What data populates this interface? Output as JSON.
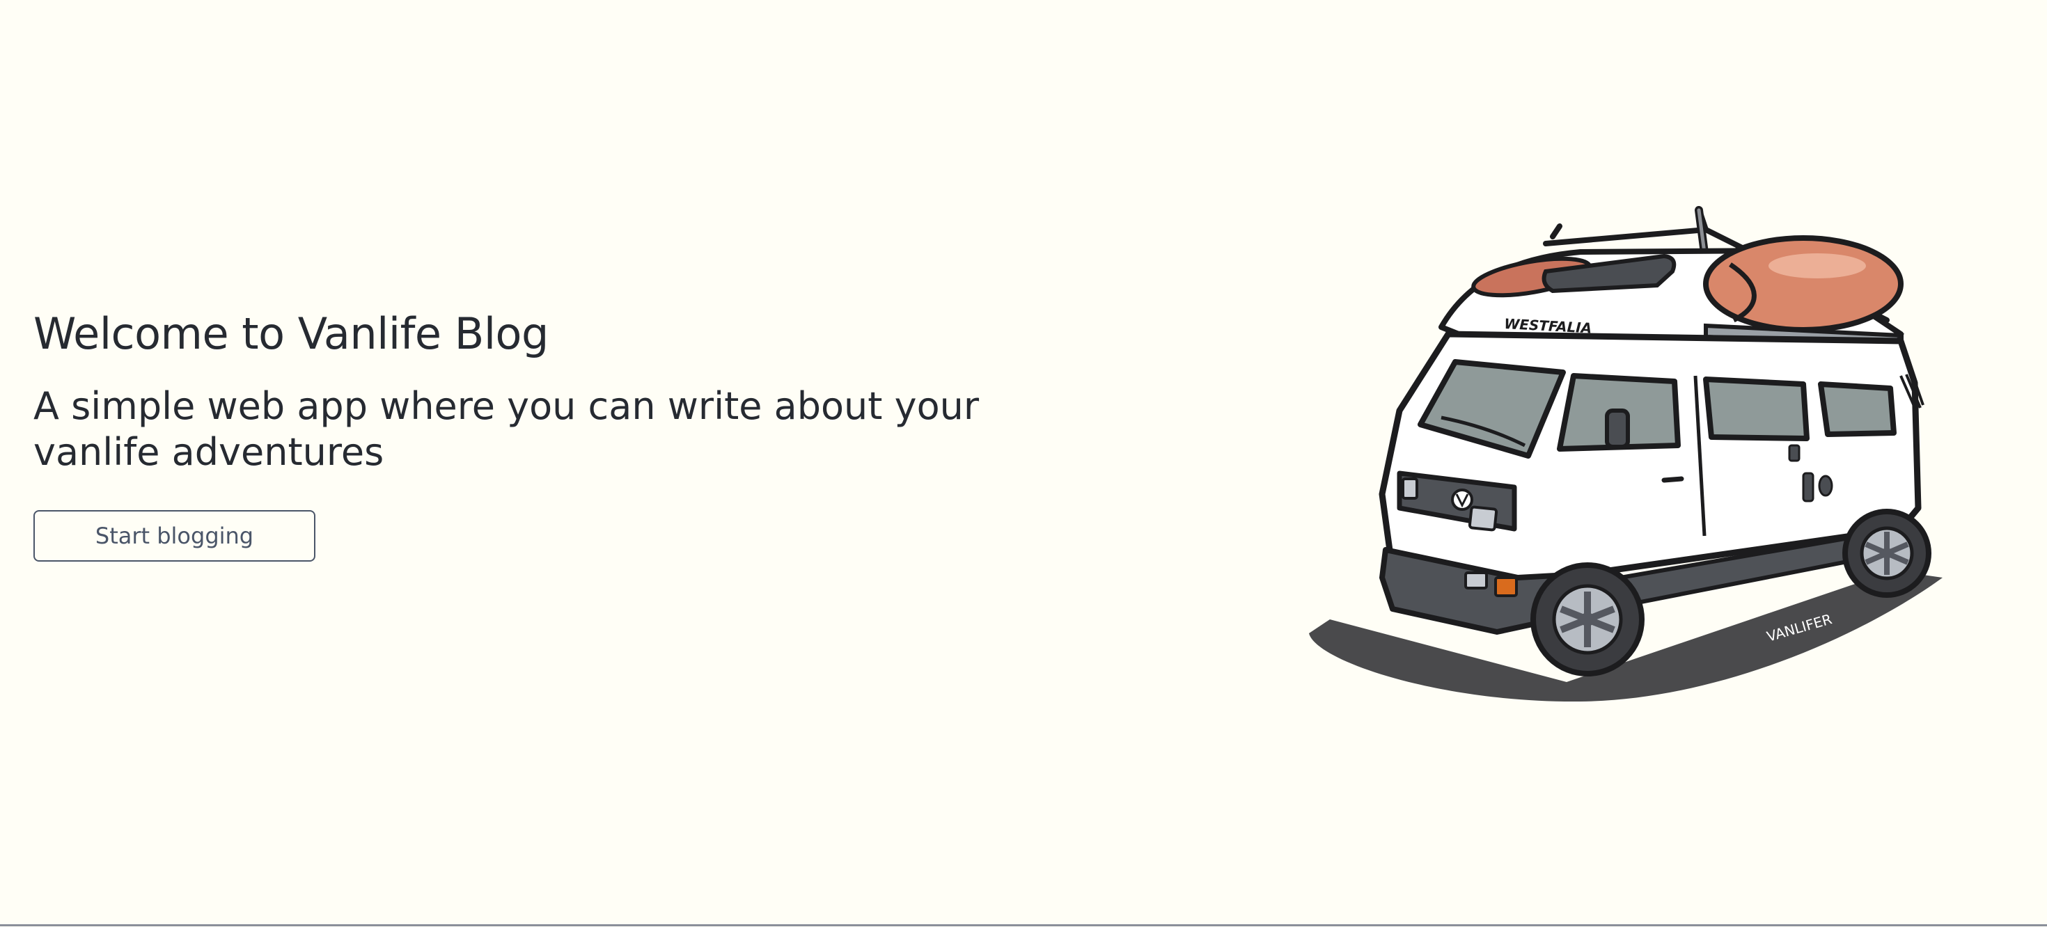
{
  "hero": {
    "title": "Welcome to Vanlife Blog",
    "subtitle": "A simple web app where you can write about your vanlife adventures",
    "cta_label": "Start blogging"
  },
  "illustration": {
    "subject": "westfalia-camper-van-with-kayaks",
    "roof_text": "WESTFALIA",
    "signature": "VANLIFER",
    "colors": {
      "body": "#ffffff",
      "outline": "#1c1c1e",
      "kayak": "#d9876a",
      "window": "#8f9a99",
      "bumper": "#4f5257",
      "shadow": "#4a4a4c",
      "indicator": "#d96b1d"
    }
  },
  "theme": {
    "background": "#fffef6",
    "text": "#262a31",
    "button_border": "#4a5568"
  }
}
